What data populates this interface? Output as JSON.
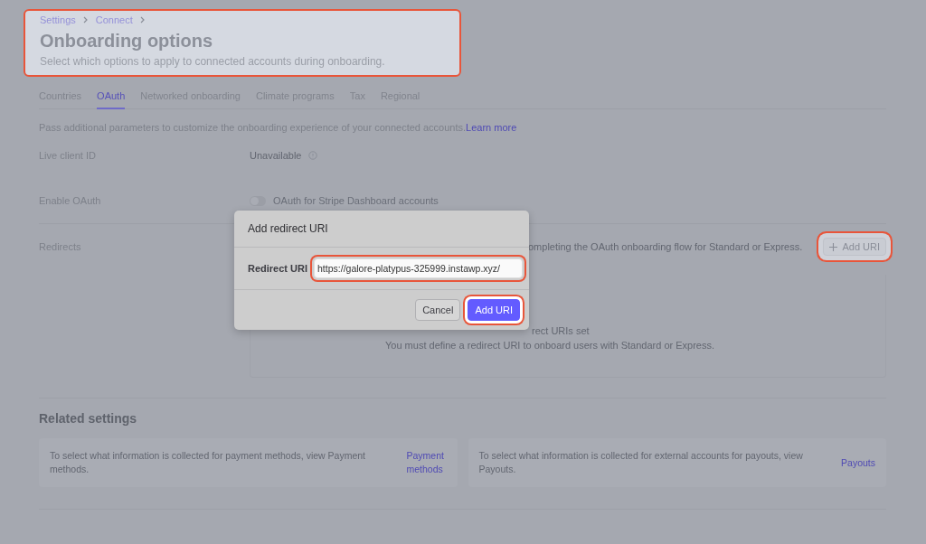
{
  "header": {
    "highlighted": true,
    "breadcrumb": [
      "Settings",
      "Connect"
    ],
    "title": "Onboarding options",
    "subtitle": "Select which options to apply to connected accounts during onboarding."
  },
  "tabs": [
    {
      "label": "Countries",
      "selected": false
    },
    {
      "label": "OAuth",
      "selected": true
    },
    {
      "label": "Networked onboarding",
      "selected": false
    },
    {
      "label": "Climate programs",
      "selected": false
    },
    {
      "label": "Tax",
      "selected": false
    },
    {
      "label": "Regional",
      "selected": false
    }
  ],
  "intro": {
    "text": "Pass additional parameters to customize the onboarding experience of your connected accounts.",
    "link": "Learn more"
  },
  "settings": [
    {
      "kind": "text",
      "label": "Live client ID",
      "value": "Unavailable"
    },
    {
      "kind": "toggle",
      "label": "Enable OAuth",
      "value": "OAuth for Stripe Dashboard accounts",
      "on": false
    },
    {
      "kind": "redirects",
      "label": "Redirects",
      "value": "ompleting the OAuth onboarding flow for Standard or Express.",
      "button": "Add URI",
      "highlighted": true
    }
  ],
  "empty_state": {
    "title": "rect URIs set",
    "text": "You must define a redirect URI to onboard users with Standard or Express."
  },
  "related": {
    "title": "Related settings",
    "cards": [
      {
        "text": "To select what information is collected for payment methods, view Payment methods.",
        "link": "Payment methods"
      },
      {
        "text": "To select what information is collected for external accounts for payouts, view Payouts.",
        "link": "Payouts"
      }
    ]
  },
  "dialog": {
    "title": "Add redirect URI",
    "field_label": "Redirect URI",
    "value": "https://galore-platypus-325999.instawp.xyz/",
    "field_highlighted": true,
    "buttons": [
      {
        "label": "Cancel",
        "kind": "secondary",
        "highlighted": false
      },
      {
        "label": "Add URI",
        "kind": "primary",
        "highlighted": true
      }
    ]
  }
}
